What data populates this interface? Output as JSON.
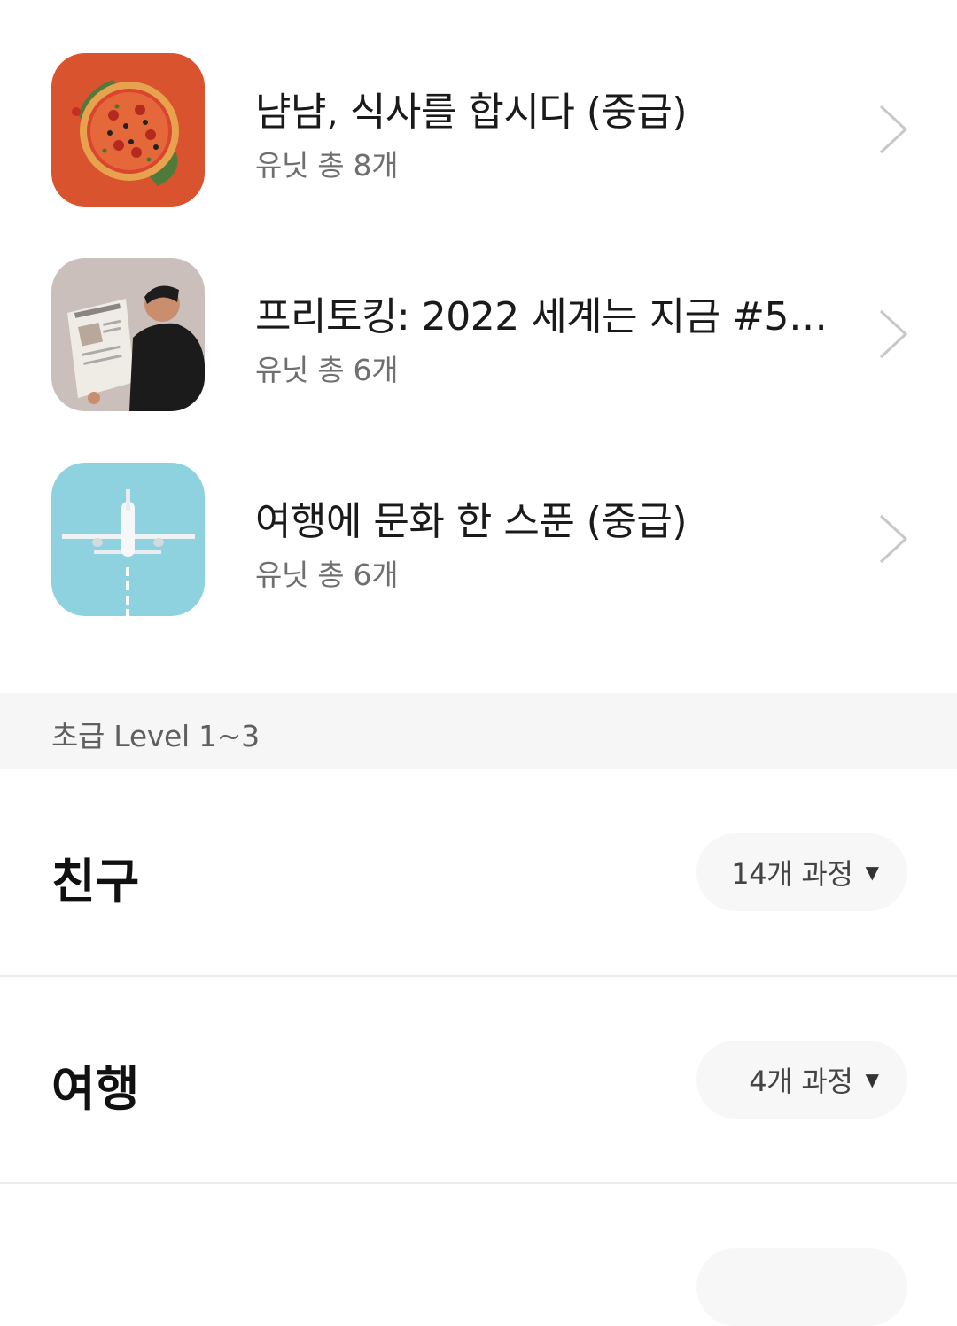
{
  "courses": [
    {
      "title": "냠냠, 식사를 합시다 (중급)",
      "units": "유닛 총 8개",
      "thumbnail_icon": "pizza-image"
    },
    {
      "title": "프리토킹: 2022 세계는 지금 #5 (...",
      "units": "유닛 총 6개",
      "thumbnail_icon": "newspaper-reader-image"
    },
    {
      "title": "여행에 문화 한 스푼 (중급)",
      "units": "유닛 총 6개",
      "thumbnail_icon": "airplane-image"
    }
  ],
  "level_section": {
    "label": "초급 Level 1~3"
  },
  "categories": [
    {
      "name": "친구",
      "count": "14개 과정",
      "caret": "▼"
    },
    {
      "name": "여행",
      "count": "4개 과정",
      "caret": "▼"
    }
  ],
  "colors": {
    "pizza_bg": "#d9532f",
    "newspaper_bg": "#cbbfbb",
    "airplane_bg": "#8fd2df",
    "level_band_bg": "#f6f6f6",
    "pill_bg": "#f7f7f7"
  }
}
